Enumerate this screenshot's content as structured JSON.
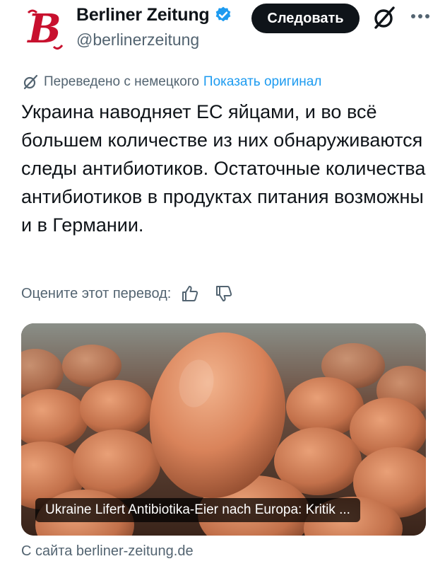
{
  "header": {
    "account_name": "Berliner Zeitung",
    "handle": "@berlinerzeitung",
    "follow_label": "Следовать",
    "avatar_letter": "B",
    "verified_color": "#1d9bf0"
  },
  "translation": {
    "label": "Переведено с немецкого",
    "show_original": "Показать оригинал"
  },
  "tweet": {
    "text": "Украина наводняет ЕС яйцами, и во всё большем количестве из них обнаруживаются следы антибиотиков. Остаточные количества антибиотиков в продуктах питания возможны и в Германии."
  },
  "rating": {
    "label": "Оцените этот перевод:"
  },
  "media": {
    "caption": "Ukraine Lifert Antibiotika-Eier nach Europa: Kritik ...",
    "source": "С сайта berliner-zeitung.de"
  },
  "icons": {
    "verified": "verified-badge-icon",
    "grok": "grok-icon",
    "more": "more-dots-icon",
    "translate": "translate-icon",
    "thumbs_up": "thumbs-up-icon",
    "thumbs_down": "thumbs-down-icon"
  },
  "colors": {
    "brand_red": "#c8102e",
    "link": "#1d9bf0",
    "muted": "#536471"
  }
}
